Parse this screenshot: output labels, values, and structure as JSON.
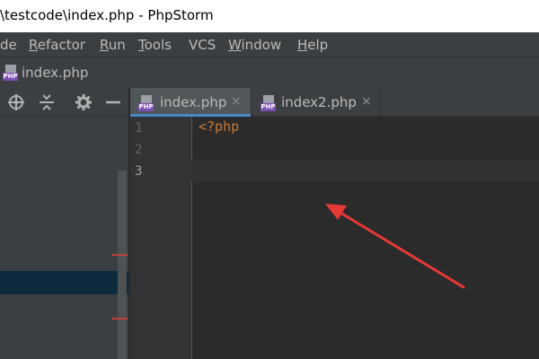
{
  "window": {
    "title": "\\testcode\\index.php - PhpStorm"
  },
  "menu": [
    {
      "label": "de",
      "mnemonic": ""
    },
    {
      "label": "efactor",
      "mnemonic": "R"
    },
    {
      "label": "un",
      "mnemonic": "R"
    },
    {
      "label": "ools",
      "mnemonic": "T"
    },
    {
      "label": "VCS",
      "mnemonic": ""
    },
    {
      "label": "indow",
      "mnemonic": "W"
    },
    {
      "label": "elp",
      "mnemonic": "H"
    }
  ],
  "navbar": {
    "file": "index.php",
    "file_icon": "php-file-icon"
  },
  "project_toolbar": {
    "icons": [
      "target-icon",
      "collapse-icon",
      "gear-icon",
      "minimize-icon"
    ]
  },
  "tabs": [
    {
      "label": "index.php",
      "active": true,
      "close": "×"
    },
    {
      "label": "index2.php",
      "active": false,
      "close": "×"
    }
  ],
  "php_badge": "PHP",
  "editor": {
    "line_numbers": [
      "1",
      "2",
      "3"
    ],
    "current_line": 3,
    "lines": [
      "<?php",
      "",
      ""
    ]
  },
  "colors": {
    "keyword": "#cc7832",
    "annotation_arrow": "#e53935",
    "tab_underline": "#4a88c7"
  }
}
